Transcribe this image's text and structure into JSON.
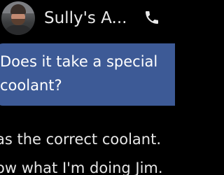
{
  "header": {
    "contact_name": "Sully's A...",
    "avatar_icon": "contact-avatar-photo",
    "call_icon": "phone-icon"
  },
  "conversation": {
    "outgoing_message": "Does it take a special\ncoolant?",
    "incoming_lines": [
      "as the correct coolant.",
      "ow what I'm doing Jim."
    ]
  },
  "colors": {
    "background": "#000000",
    "bubble": "#3d5a96",
    "text": "#e6e6e6"
  }
}
